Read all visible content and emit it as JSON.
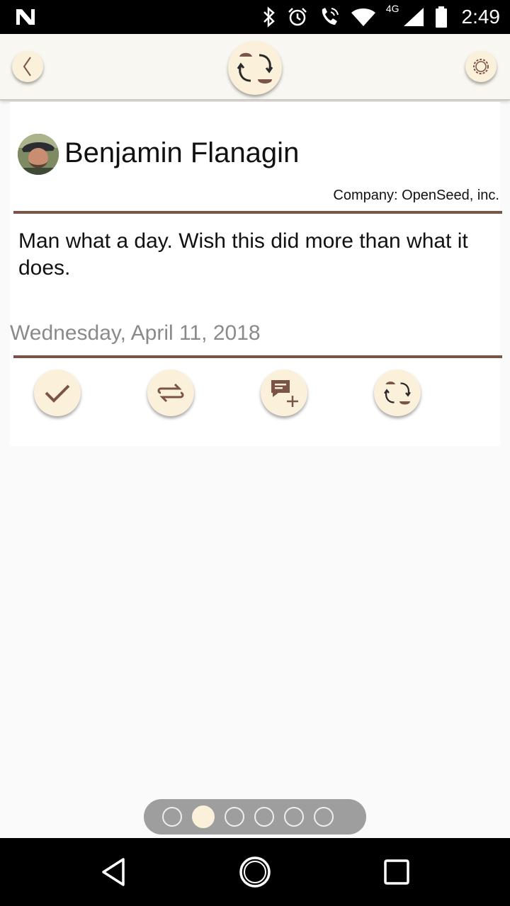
{
  "status_bar": {
    "network": "4G",
    "time": "2:49",
    "icons": [
      "n-logo-icon",
      "bluetooth-icon",
      "alarm-icon",
      "wifi-calling-icon",
      "wifi-icon",
      "signal-icon",
      "battery-icon"
    ]
  },
  "header": {
    "icons": [
      "back-chevron-icon",
      "app-logo-icon",
      "settings-gear-icon"
    ]
  },
  "contact": {
    "name": "Benjamin Flanagin",
    "company": "Company: OpenSeed, inc."
  },
  "entry": {
    "message": "Man what a day. Wish this did more than what it does.",
    "date": "Wednesday, April 11, 2018"
  },
  "actions": [
    "check-icon",
    "swap-icon",
    "add-comment-icon",
    "sync-icon"
  ],
  "pager": {
    "count": 6,
    "active_index": 1
  },
  "colors": {
    "accent": "#7a5446",
    "button_bg": "#fbf0da",
    "header_bg": "#f8f7f1"
  }
}
